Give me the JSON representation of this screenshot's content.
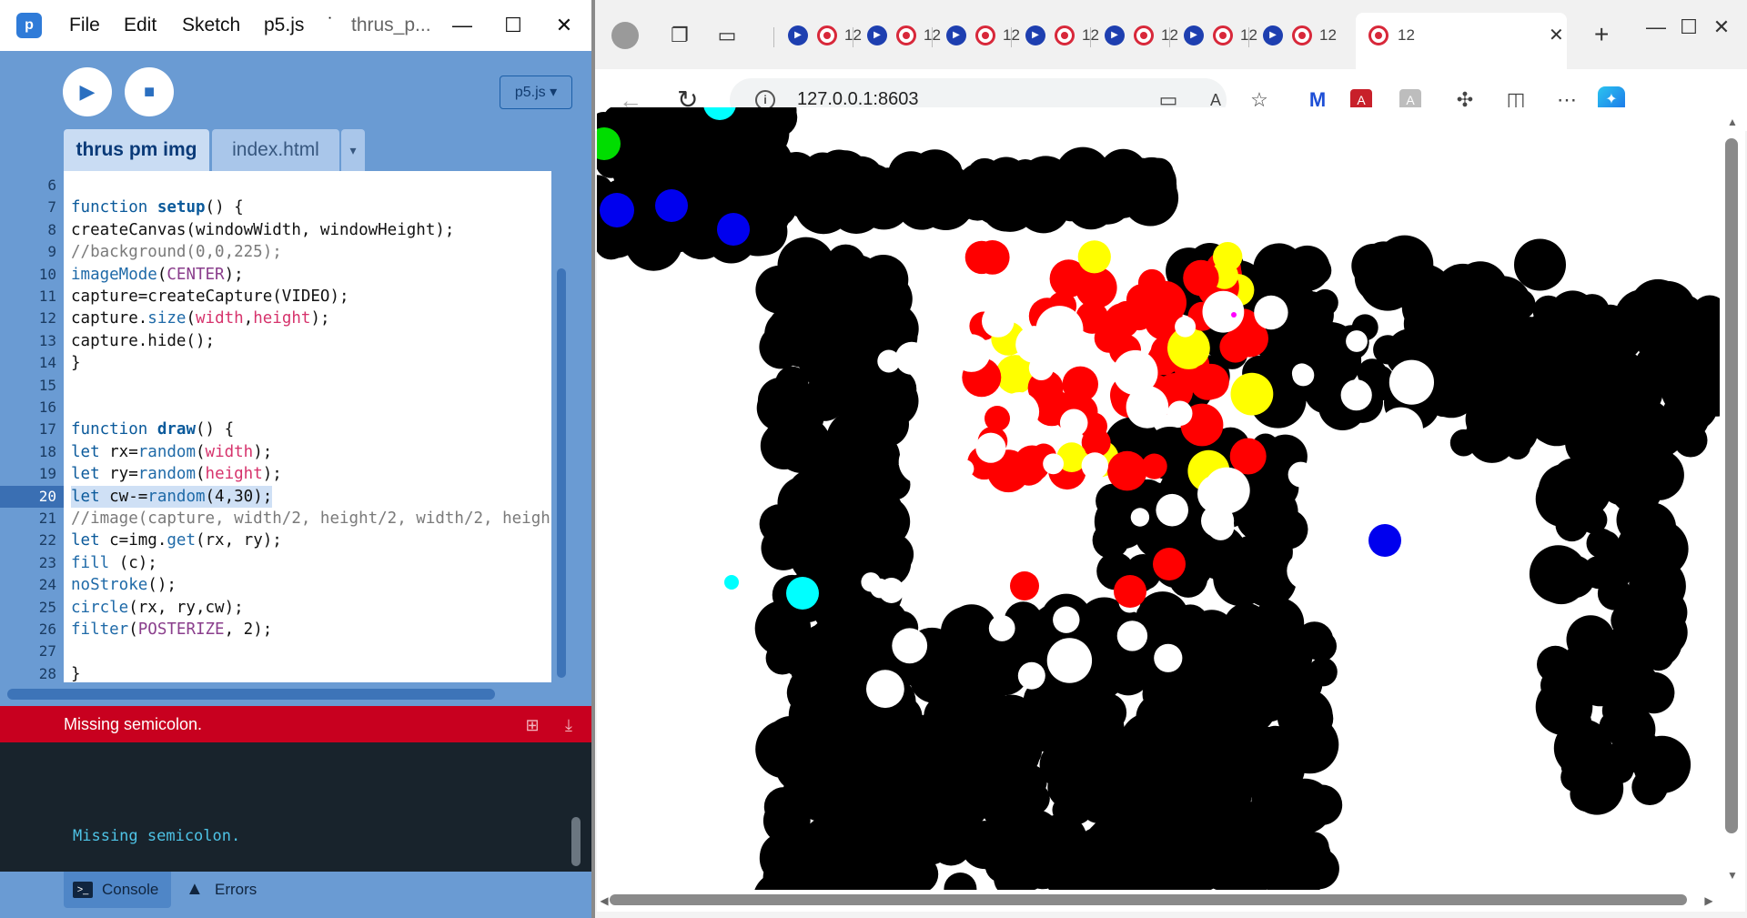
{
  "editor": {
    "menu": [
      "File",
      "Edit",
      "Sketch",
      "p5.js",
      "˙",
      "thrus_p..."
    ],
    "window_controls": [
      "—",
      "☐",
      "✕"
    ],
    "play_label": "▶",
    "stop_label": "■",
    "library_select": "p5.js ▾",
    "tabs": [
      {
        "label": "thrus pm img",
        "active": true
      },
      {
        "label": "index.html",
        "active": false
      }
    ],
    "tab_more": "▾",
    "line_numbers": [
      "6",
      "7",
      "8",
      "9",
      "10",
      "11",
      "12",
      "13",
      "14",
      "15",
      "16",
      "17",
      "18",
      "19",
      "20",
      "21",
      "22",
      "23",
      "24",
      "25",
      "26",
      "27",
      "28"
    ],
    "current_line": "20",
    "code_lines": [
      "",
      "function setup() {",
      "createCanvas(windowWidth, windowHeight);",
      "//background(0,0,225);",
      "imageMode(CENTER);",
      "capture=createCapture(VIDEO);",
      "capture.size(width,height);",
      "capture.hide();",
      "}",
      "",
      "",
      "function draw() {",
      "let rx=random(width);",
      "let ry=random(height);",
      "let cw-=random(4,30);",
      "//image(capture, width/2, height/2, width/2, heigh",
      "let c=img.get(rx, ry);",
      "fill (c);",
      "noStroke();",
      "circle(rx, ry,cw);",
      "filter(POSTERIZE, 2);",
      "",
      "}"
    ],
    "console": {
      "banner": "Missing semicolon.",
      "message": "Missing semicolon.",
      "tab_console": "Console",
      "tab_errors": "Errors"
    }
  },
  "browser": {
    "url": "127.0.0.1:8603",
    "tab_number": "12",
    "active_tab_number": "12",
    "tab_close": "✕",
    "new_tab": "+",
    "window_controls": [
      "—",
      "☐",
      "✕"
    ],
    "colors": {
      "black": "#000000",
      "red": "#ff0000",
      "yellow": "#ffff00",
      "blue": "#0000ee",
      "cyan": "#00ffff",
      "green": "#00dd00",
      "magenta": "#ff00ff"
    }
  }
}
